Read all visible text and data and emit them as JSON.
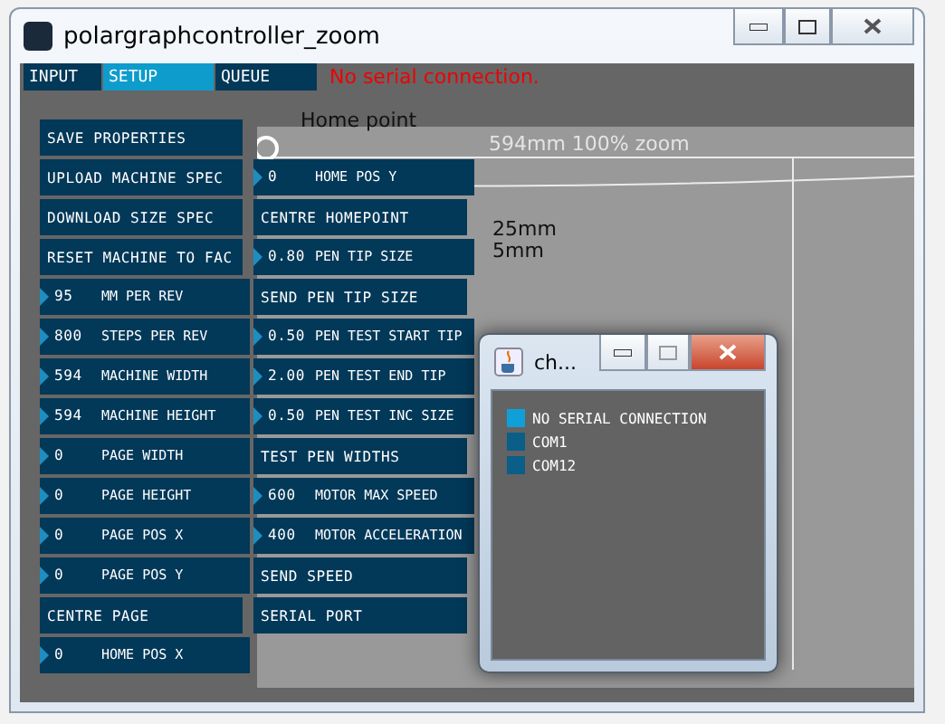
{
  "window": {
    "title": "polargraphcontroller_zoom"
  },
  "tabs": [
    {
      "label": "INPUT",
      "selected": false
    },
    {
      "label": "SETUP",
      "selected": true
    },
    {
      "label": "QUEUE",
      "selected": false
    }
  ],
  "status": "No serial connection.",
  "canvas": {
    "labels": [
      "Home point",
      "594mm 100% zoom",
      "25mm",
      "5mm"
    ]
  },
  "controls_left": [
    {
      "kind": "action",
      "label": "SAVE PROPERTIES"
    },
    {
      "kind": "action",
      "label": "UPLOAD MACHINE SPEC"
    },
    {
      "kind": "action",
      "label": "DOWNLOAD SIZE SPEC"
    },
    {
      "kind": "action",
      "label": "RESET MACHINE TO FAC"
    },
    {
      "kind": "number",
      "value": "95",
      "label": "MM PER REV"
    },
    {
      "kind": "number",
      "value": "800",
      "label": "STEPS PER REV"
    },
    {
      "kind": "number",
      "value": "594",
      "label": "MACHINE WIDTH"
    },
    {
      "kind": "number",
      "value": "594",
      "label": "MACHINE HEIGHT"
    },
    {
      "kind": "number",
      "value": "0",
      "label": "PAGE WIDTH"
    },
    {
      "kind": "number",
      "value": "0",
      "label": "PAGE HEIGHT"
    },
    {
      "kind": "number",
      "value": "0",
      "label": "PAGE POS X"
    },
    {
      "kind": "number",
      "value": "0",
      "label": "PAGE POS Y"
    },
    {
      "kind": "action",
      "label": "CENTRE PAGE"
    },
    {
      "kind": "number",
      "value": "0",
      "label": "HOME POS X"
    }
  ],
  "controls_right": [
    {
      "kind": "number",
      "value": "0",
      "label": "HOME POS Y"
    },
    {
      "kind": "action",
      "label": "CENTRE HOMEPOINT"
    },
    {
      "kind": "number",
      "value": "0.80",
      "label": "PEN TIP SIZE"
    },
    {
      "kind": "action",
      "label": "SEND PEN TIP SIZE"
    },
    {
      "kind": "number",
      "value": "0.50",
      "label": "PEN TEST START TIP"
    },
    {
      "kind": "number",
      "value": "2.00",
      "label": "PEN TEST END TIP"
    },
    {
      "kind": "number",
      "value": "0.50",
      "label": "PEN TEST INC SIZE"
    },
    {
      "kind": "action",
      "label": "TEST PEN WIDTHS"
    },
    {
      "kind": "number",
      "value": "600",
      "label": "MOTOR MAX SPEED"
    },
    {
      "kind": "number",
      "value": "400",
      "label": "MOTOR ACCELERATION"
    },
    {
      "kind": "action",
      "label": "SEND SPEED"
    },
    {
      "kind": "action",
      "label": "SERIAL PORT"
    }
  ],
  "dialog": {
    "title": "ch...",
    "ports": [
      {
        "label": "NO SERIAL CONNECTION",
        "selected": true
      },
      {
        "label": "COM1",
        "selected": false
      },
      {
        "label": "COM12",
        "selected": false
      }
    ]
  }
}
